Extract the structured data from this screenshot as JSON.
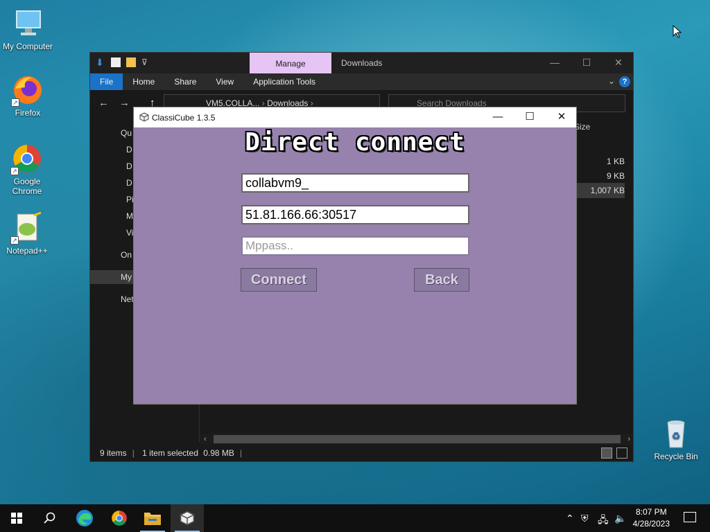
{
  "desktop": {
    "icons": [
      {
        "label": "My Computer",
        "icon": "monitor-icon"
      },
      {
        "label": "Firefox",
        "icon": "firefox-icon"
      },
      {
        "label": "Google Chrome",
        "icon": "chrome-icon"
      },
      {
        "label": "Notepad++",
        "icon": "notepadpp-icon"
      },
      {
        "label": "Recycle Bin",
        "icon": "recycle-bin-icon"
      }
    ]
  },
  "explorer": {
    "manage_tab": "Manage",
    "title": "Downloads",
    "ribbon_tabs": [
      "File",
      "Home",
      "Share",
      "View",
      "Application Tools"
    ],
    "address": {
      "segment1": "VM5.COLLA...",
      "segment2": "Downloads"
    },
    "search_placeholder": "Search Downloads",
    "column_header": "Size",
    "nav_items": [
      "Qu",
      "D",
      "D",
      "D",
      "Pi",
      "M",
      "Vi",
      "On",
      "My",
      "Net"
    ],
    "file_sizes": [
      "1 KB",
      "9 KB",
      "1,007 KB"
    ],
    "status": {
      "items": "9 items",
      "selected": "1 item selected",
      "size": "0.98 MB"
    }
  },
  "classicube": {
    "title": "ClassiCube 1.3.5",
    "heading": "Direct connect",
    "username": "collabvm9_",
    "address": "51.81.166.66:30517",
    "mppass_placeholder": "Mppass..",
    "connect_label": "Connect",
    "back_label": "Back"
  },
  "taskbar": {
    "time": "8:07 PM",
    "date": "4/28/2023"
  },
  "colors": {
    "desktop": "#1f7fa3",
    "explorer_bg": "#191919",
    "manage_tab": "#e6c5f5",
    "classicube_bg": "#9682ad",
    "taskbar": "#101010"
  }
}
